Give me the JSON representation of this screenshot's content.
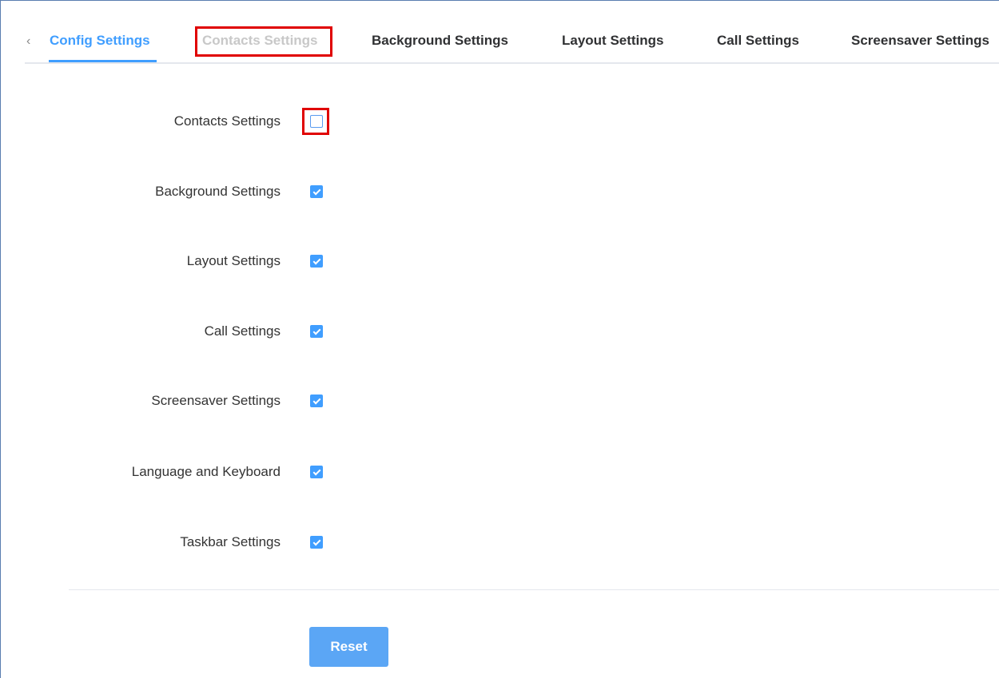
{
  "tabs": {
    "prev_arrow": "‹",
    "items": [
      {
        "label": "Config Settings",
        "state": "active"
      },
      {
        "label": "Contacts Settings",
        "state": "disabled"
      },
      {
        "label": "Background Settings",
        "state": "normal"
      },
      {
        "label": "Layout Settings",
        "state": "normal"
      },
      {
        "label": "Call Settings",
        "state": "normal"
      },
      {
        "label": "Screensaver Settings",
        "state": "normal"
      }
    ]
  },
  "form": {
    "rows": [
      {
        "label": "Contacts Settings",
        "checked": false
      },
      {
        "label": "Background Settings",
        "checked": true
      },
      {
        "label": "Layout Settings",
        "checked": true
      },
      {
        "label": "Call Settings",
        "checked": true
      },
      {
        "label": "Screensaver Settings",
        "checked": true
      },
      {
        "label": "Language and Keyboard",
        "checked": true
      },
      {
        "label": "Taskbar Settings",
        "checked": true
      }
    ]
  },
  "actions": {
    "reset_label": "Reset"
  },
  "colors": {
    "accent": "#409eff",
    "highlight": "#e00000",
    "button": "#5ba6f5"
  }
}
